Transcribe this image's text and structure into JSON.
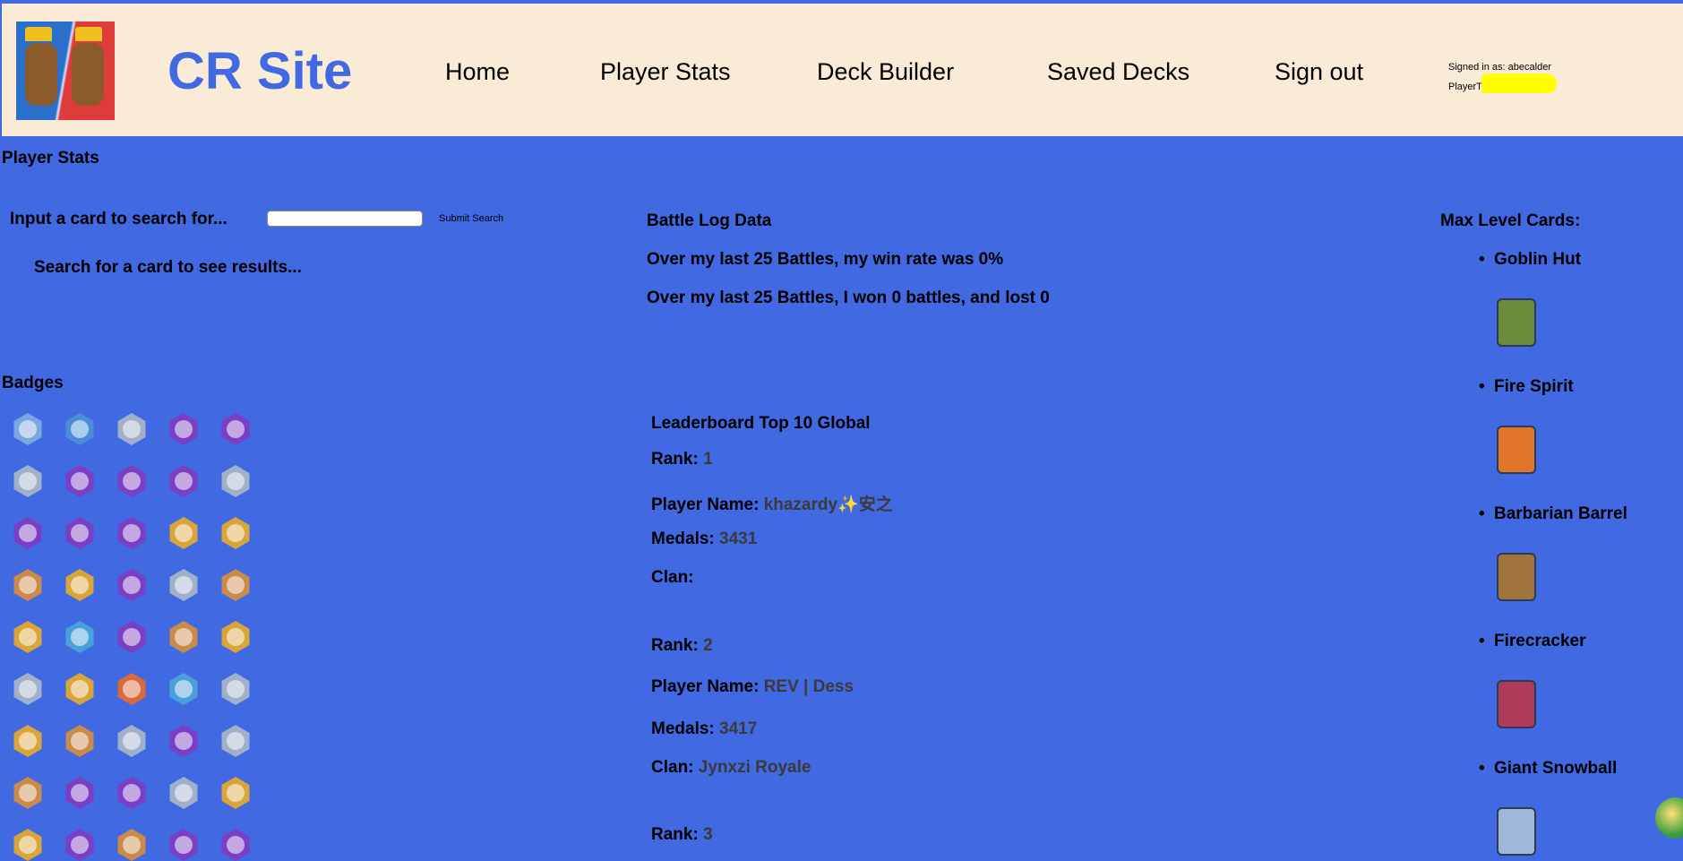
{
  "header": {
    "site_title": "CR Site",
    "nav": [
      "Home",
      "Player Stats",
      "Deck Builder",
      "Saved Decks",
      "Sign out"
    ],
    "signed_in": "Signed in as: abecalder",
    "player_tag_label": "PlayerTag:"
  },
  "page_title": "Player Stats",
  "search": {
    "label": "Input a card to search for...",
    "value": "",
    "button": "Submit Search",
    "result": "Search for a card to see results..."
  },
  "battle_log": {
    "title": "Battle Log Data",
    "win_rate": "Over my last 25 Battles, my win rate was 0%",
    "record": "Over my last 25 Battles, I won 0 battles, and lost 0"
  },
  "badges": {
    "title": "Badges",
    "colors": [
      "#7aa7e0",
      "#4a8fd6",
      "#9fb0c8",
      "#7a3fc4",
      "#7a3fc4",
      "#9fb0c8",
      "#7a3fc4",
      "#7a3fc4",
      "#7a3fc4",
      "#9fb0c8",
      "#7a3fc4",
      "#7a3fc4",
      "#7a3fc4",
      "#d9a53a",
      "#d9a53a",
      "#c98a4a",
      "#d9a53a",
      "#7a3fc4",
      "#9fb0c8",
      "#c98a4a",
      "#d9a53a",
      "#4aa0d9",
      "#7a3fc4",
      "#c98a4a",
      "#d9a53a",
      "#9fb0c8",
      "#d9a53a",
      "#d96a3a",
      "#4aa0d9",
      "#9fb0c8",
      "#d9a53a",
      "#c98a4a",
      "#9fb0c8",
      "#7a3fc4",
      "#9fb0c8",
      "#c98a4a",
      "#7a3fc4",
      "#7a3fc4",
      "#9fb0c8",
      "#d9a53a",
      "#d9a53a",
      "#7a3fc4",
      "#c98a4a",
      "#7a3fc4",
      "#7a3fc4"
    ]
  },
  "leaderboard": {
    "title": "Leaderboard Top 10 Global",
    "labels": {
      "rank": "Rank:",
      "name": "Player Name:",
      "medals": "Medals:",
      "clan": "Clan:"
    },
    "entries": [
      {
        "rank": "1",
        "name": "khazardy✨安之",
        "medals": "3431",
        "clan": ""
      },
      {
        "rank": "2",
        "name": "REV | Dess",
        "medals": "3417",
        "clan": "Jynxzi Royale"
      },
      {
        "rank": "3",
        "name": "",
        "medals": "",
        "clan": ""
      }
    ]
  },
  "max_level": {
    "title": "Max Level Cards:",
    "cards": [
      {
        "name": "Goblin Hut",
        "color": "#6b8a3a"
      },
      {
        "name": "Fire Spirit",
        "color": "#e0762a"
      },
      {
        "name": "Barbarian Barrel",
        "color": "#a0743a"
      },
      {
        "name": "Firecracker",
        "color": "#b03a5a"
      },
      {
        "name": "Giant Snowball",
        "color": "#9fb8d9"
      }
    ]
  }
}
